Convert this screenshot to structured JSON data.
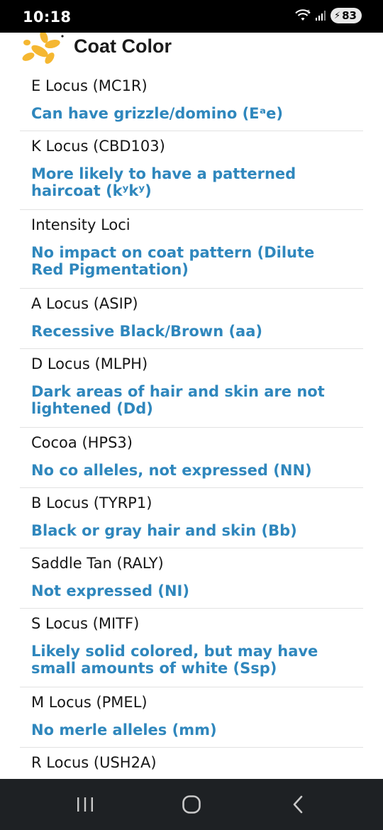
{
  "status_bar": {
    "time": "10:18",
    "wifi_icon": "wifi-icon",
    "signal_icon": "signal-icon",
    "battery": "83"
  },
  "header": {
    "title": "Coat Color",
    "logo_icon": "dog-balloon-logo",
    "logo_color": "#f5b731"
  },
  "rows": [
    {
      "label": "E Locus (MC1R)",
      "value": "Can have grizzle/domino (Eᵃe)"
    },
    {
      "label": "K Locus (CBD103)",
      "value": "More likely to have a patterned haircoat (kʸkʸ)"
    },
    {
      "label": "Intensity Loci",
      "value": "No impact on coat pattern (Dilute Red Pigmentation)"
    },
    {
      "label": "A Locus (ASIP)",
      "value": "Recessive Black/Brown (aa)"
    },
    {
      "label": "D Locus (MLPH)",
      "value": "Dark areas of hair and skin are not lightened (Dd)"
    },
    {
      "label": "Cocoa (HPS3)",
      "value": "No co alleles, not expressed (NN)"
    },
    {
      "label": "B Locus (TYRP1)",
      "value": "Black or gray hair and skin (Bb)"
    },
    {
      "label": "Saddle Tan (RALY)",
      "value": "Not expressed (NI)"
    },
    {
      "label": "S Locus (MITF)",
      "value": "Likely solid colored, but may have small amounts of white (Ssp)"
    },
    {
      "label": "M Locus (PMEL)",
      "value": "No merle alleles (mm)"
    },
    {
      "label": "R Locus (USH2A)",
      "value": ""
    }
  ],
  "colors": {
    "value_text": "#2f87bd",
    "label_text": "#161616",
    "divider": "#e2e2e2",
    "nav_bar": "#1e2124"
  },
  "nav": {
    "recent_icon": "recent-apps-icon",
    "home_icon": "home-icon",
    "back_icon": "back-icon"
  }
}
